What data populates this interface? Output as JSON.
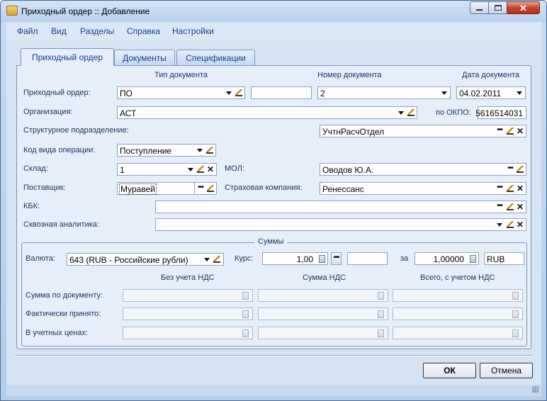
{
  "window": {
    "title": "Приходный ордер :: Добавление"
  },
  "menu": [
    "Файл",
    "Вид",
    "Разделы",
    "Справка",
    "Настройки"
  ],
  "tabs": [
    "Приходный ордер",
    "Документы",
    "Спецификации"
  ],
  "headers": {
    "doc_type": "Тип документа",
    "doc_number": "Номер документа",
    "doc_date": "Дата документа"
  },
  "labels": {
    "order": "Приходный ордер:",
    "org": "Организация:",
    "okpo": "по ОКПО:",
    "division": "Структурное подразделение:",
    "op_code": "Код вида операции:",
    "warehouse": "Склад:",
    "mol": "МОЛ:",
    "supplier": "Поставщик:",
    "insurer": "Страховая компания:",
    "kbk": "КБК:",
    "analytics": "Сквозная аналитика:"
  },
  "values": {
    "doc_type": "ПО",
    "doc_extra": "",
    "doc_number": "2",
    "doc_date": "04.02.2011",
    "org": "АСТ",
    "okpo": "5616514031",
    "division": "УчтнРасчОтдел",
    "op_code": "Поступление",
    "warehouse": "1",
    "mol": "Оводов Ю.А.",
    "supplier": "Муравей",
    "insurer": "Ренессанс",
    "kbk": "",
    "analytics": ""
  },
  "sums": {
    "title": "Суммы",
    "currency_label": "Валюта:",
    "currency_value": "643 (RUB - Российские рубли)",
    "rate_label": "Курс:",
    "rate_value": "1,00",
    "rate_extra": "",
    "per_label": "за",
    "per_value": "1,00000",
    "per_currency": "RUB",
    "columns": [
      "Без учета НДС",
      "Сумма НДС",
      "Всего, с учетом НДС"
    ],
    "rows": [
      "Сумма по документу:",
      "Фактически принято:",
      "В учетных ценах:"
    ]
  },
  "buttons": {
    "ok": "ОК",
    "cancel": "Отмена"
  }
}
